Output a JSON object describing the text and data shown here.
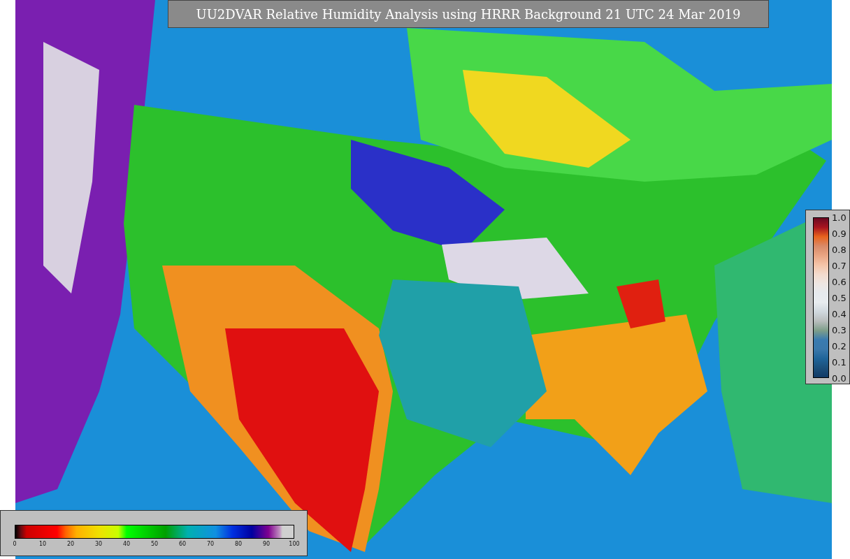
{
  "title": "UU2DVAR Relative Humidity Analysis using HRRR Background 21 UTC 24 Mar 2019",
  "side_colorbar": {
    "ticks": [
      "1.0",
      "0.9",
      "0.8",
      "0.7",
      "0.6",
      "0.5",
      "0.4",
      "0.3",
      "0.2",
      "0.1",
      "0.0"
    ]
  },
  "bottom_colorbar": {
    "ticks": [
      "0",
      "10",
      "20",
      "30",
      "40",
      "50",
      "60",
      "70",
      "80",
      "90",
      "100"
    ]
  }
}
